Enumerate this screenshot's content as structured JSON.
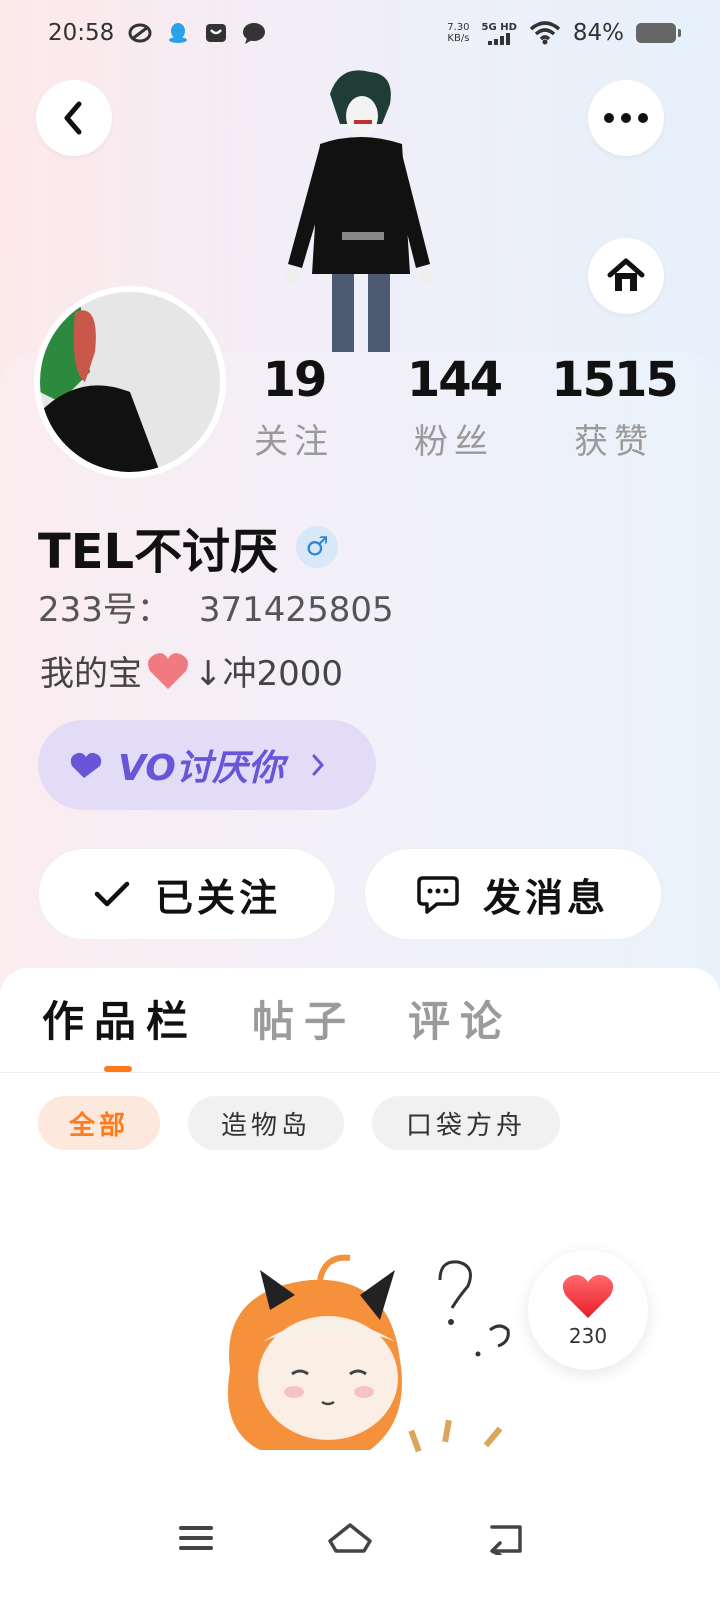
{
  "status_bar": {
    "time": "20:58",
    "net_speed_value": "7.30",
    "net_speed_unit": "KB/s",
    "network": "5G HD",
    "battery": "84%"
  },
  "profile": {
    "following_count": "19",
    "following_label": "关注",
    "followers_count": "144",
    "followers_label": "粉丝",
    "likes_count": "1515",
    "likes_label": "获赞",
    "username": "TEL不讨厌",
    "gender_symbol": "♂",
    "uid_label": "233号：",
    "uid_value": "371425805",
    "bio_prefix": "我的宝",
    "bio_suffix": "↓冲2000",
    "tag_text": "VO讨厌你",
    "follow_button": "已关注",
    "message_button": "发消息"
  },
  "tabs": [
    "作品栏",
    "帖子",
    "评论"
  ],
  "filters": [
    "全部",
    "造物岛",
    "口袋方舟"
  ],
  "like_float": {
    "count": "230"
  },
  "icons": {
    "back": "chevron-left-icon",
    "more": "more-icon",
    "home": "home-icon",
    "check": "check-icon",
    "chat": "chat-icon"
  },
  "colors": {
    "accent": "#ff7a1a",
    "tag_purple": "#6a55d8",
    "gender_blue": "#2f86d8"
  }
}
